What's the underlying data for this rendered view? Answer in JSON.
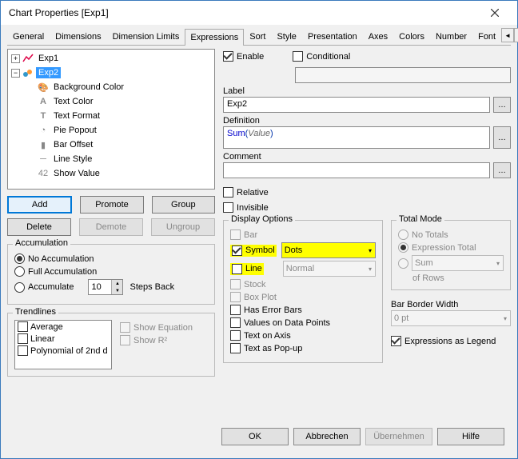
{
  "title": "Chart Properties [Exp1]",
  "tabs": [
    "General",
    "Dimensions",
    "Dimension Limits",
    "Expressions",
    "Sort",
    "Style",
    "Presentation",
    "Axes",
    "Colors",
    "Number",
    "Font"
  ],
  "active_tab": "Expressions",
  "tree": {
    "root1": "Exp1",
    "root2": "Exp2",
    "children": [
      "Background Color",
      "Text Color",
      "Text Format",
      "Pie Popout",
      "Bar Offset",
      "Line Style",
      "Show Value"
    ]
  },
  "buttons": {
    "add": "Add",
    "promote": "Promote",
    "group": "Group",
    "delete": "Delete",
    "demote": "Demote",
    "ungroup": "Ungroup"
  },
  "accumulation": {
    "title": "Accumulation",
    "no": "No Accumulation",
    "full": "Full Accumulation",
    "acc": "Accumulate",
    "steps_value": "10",
    "steps_label": "Steps Back"
  },
  "trendlines": {
    "title": "Trendlines",
    "items": [
      "Average",
      "Linear",
      "Polynomial of 2nd d"
    ],
    "show_eq": "Show Equation",
    "show_r2": "Show R²"
  },
  "top_checks": {
    "enable": "Enable",
    "conditional": "Conditional"
  },
  "fields": {
    "label_l": "Label",
    "label_v": "Exp2",
    "def_l": "Definition",
    "def_fn": "Sum",
    "def_arg": "Value",
    "comment_l": "Comment",
    "comment_v": ""
  },
  "mid_checks": {
    "relative": "Relative",
    "invisible": "Invisible"
  },
  "display": {
    "title": "Display Options",
    "bar": "Bar",
    "symbol": "Symbol",
    "symbol_val": "Dots",
    "line": "Line",
    "line_val": "Normal",
    "stock": "Stock",
    "box": "Box Plot",
    "error": "Has Error Bars",
    "values": "Values on Data Points",
    "text_axis": "Text on Axis",
    "text_popup": "Text as Pop-up"
  },
  "total": {
    "title": "Total Mode",
    "none": "No Totals",
    "expr": "Expression Total",
    "sum": "Sum",
    "rows": "of Rows"
  },
  "bar_border": {
    "title": "Bar Border Width",
    "val": "0 pt"
  },
  "legend": "Expressions as Legend",
  "bottom": {
    "ok": "OK",
    "cancel": "Abbrechen",
    "apply": "Übernehmen",
    "help": "Hilfe"
  }
}
